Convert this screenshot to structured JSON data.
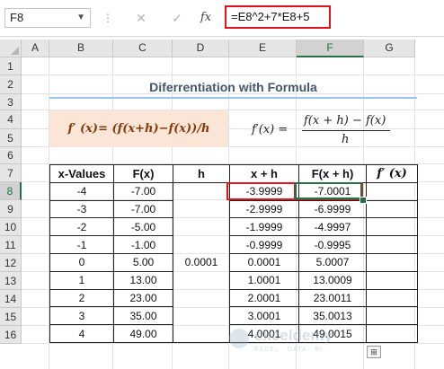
{
  "formula_bar": {
    "name_box": "F8",
    "cancel_symbol": "✕",
    "enter_symbol": "✓",
    "fx_label": "fx",
    "formula": "=E8^2+7*E8+5"
  },
  "columns": [
    "A",
    "B",
    "C",
    "D",
    "E",
    "F",
    "G"
  ],
  "selected_column": "F",
  "rows": [
    "1",
    "2",
    "3",
    "4",
    "5",
    "6",
    "7",
    "8",
    "9",
    "10",
    "11",
    "12",
    "13",
    "14",
    "15",
    "16"
  ],
  "selected_row": "8",
  "sheet": {
    "title": "Diferrentiation with Formula",
    "formula_text": "f′ (x)= (f(x+h)−f(x))/h",
    "math_lhs": "f′(x) =",
    "math_numerator": "f(x + h) − f(x)",
    "math_denominator": "h"
  },
  "table": {
    "headers": [
      "x-Values",
      "F(x)",
      "h",
      "x + h",
      "F(x + h)",
      "f′ (x)"
    ],
    "h_value": "0.0001",
    "rows": [
      {
        "x": "-4",
        "fx": "-7.00",
        "xh": "-3.9999",
        "fxh": "-7.0001"
      },
      {
        "x": "-3",
        "fx": "-7.00",
        "xh": "-2.9999",
        "fxh": "-6.9999"
      },
      {
        "x": "-2",
        "fx": "-5.00",
        "xh": "-1.9999",
        "fxh": "-4.9997"
      },
      {
        "x": "-1",
        "fx": "-1.00",
        "xh": "-0.9999",
        "fxh": "-0.9995"
      },
      {
        "x": "0",
        "fx": "5.00",
        "xh": "0.0001",
        "fxh": "5.0007"
      },
      {
        "x": "1",
        "fx": "13.00",
        "xh": "1.0001",
        "fxh": "13.0009"
      },
      {
        "x": "2",
        "fx": "23.00",
        "xh": "2.0001",
        "fxh": "23.0011"
      },
      {
        "x": "3",
        "fx": "35.00",
        "xh": "3.0001",
        "fxh": "35.0013"
      },
      {
        "x": "4",
        "fx": "49.00",
        "xh": "4.0001",
        "fxh": "49.0015"
      }
    ]
  },
  "watermark": {
    "name": "exceldemy",
    "tagline": "EXCEL · DATA · BI"
  },
  "colors": {
    "accent_green": "#217346",
    "highlight_red": "#e0141a",
    "formula_fill": "#fbe5d6"
  }
}
